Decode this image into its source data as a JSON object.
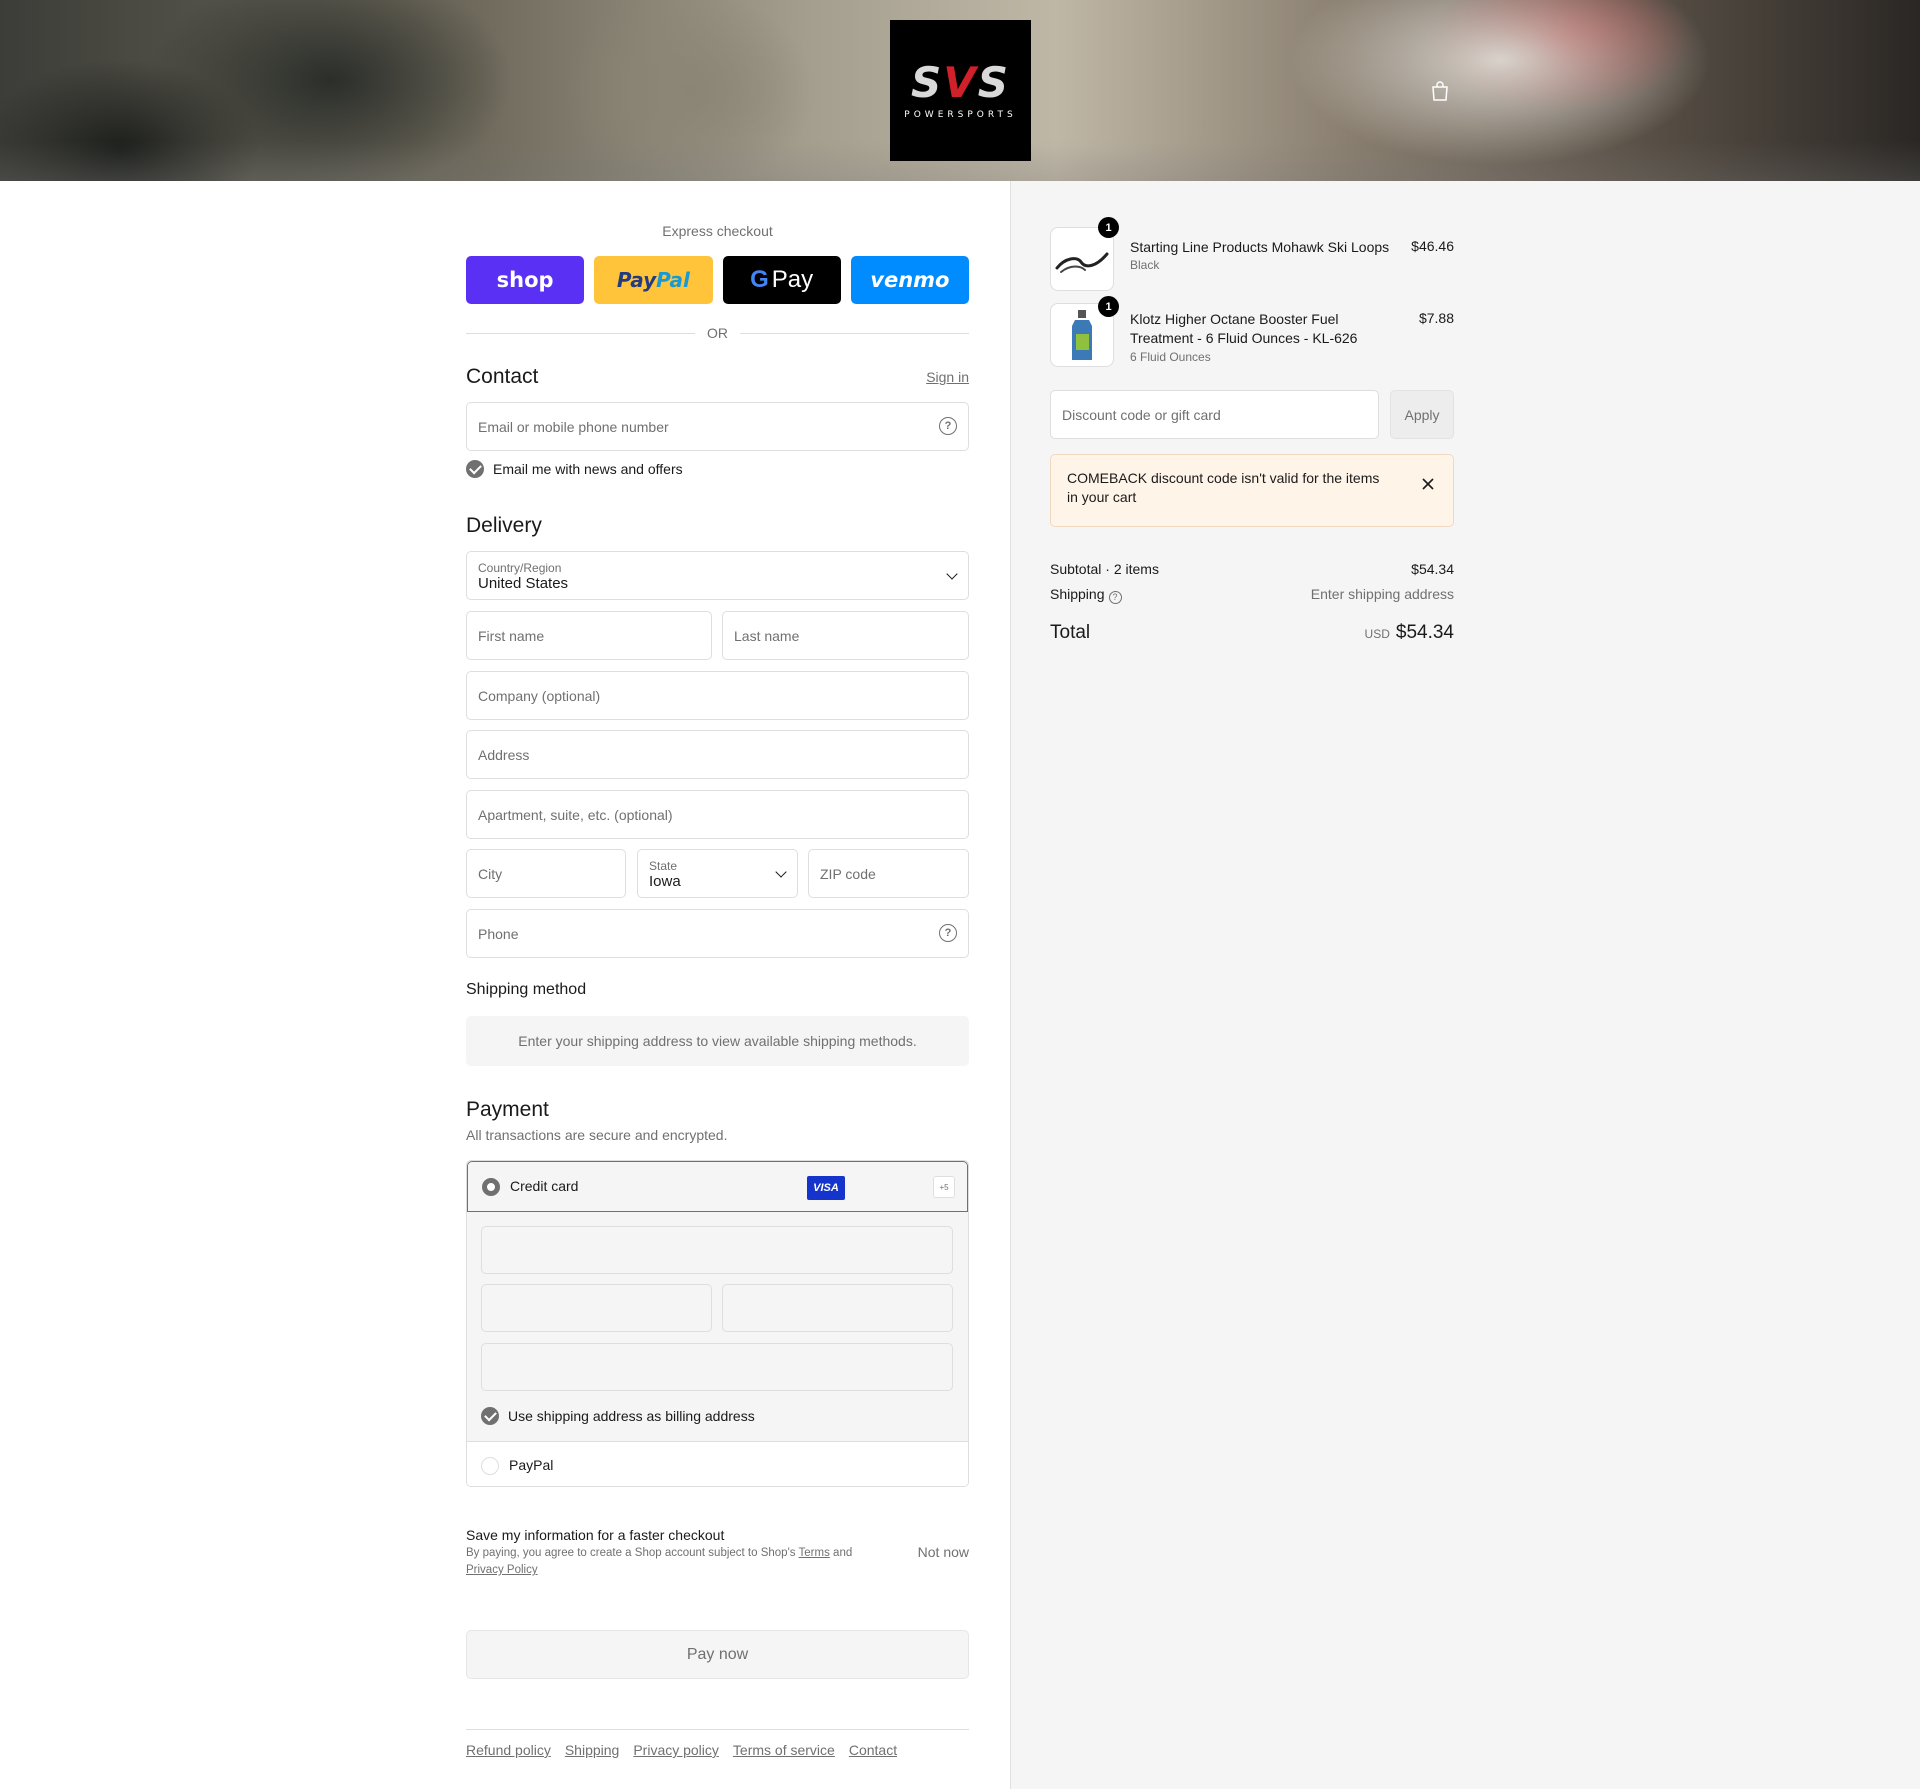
{
  "brand": {
    "logo_text": "SVS",
    "logo_sub": "POWERSPORTS"
  },
  "express": {
    "title": "Express checkout",
    "buttons": [
      "shop",
      "PayPal",
      "G Pay",
      "venmo"
    ],
    "or": "OR"
  },
  "contact": {
    "title": "Contact",
    "sign_in": "Sign in",
    "email_placeholder": "Email or mobile phone number",
    "newsletter": "Email me with news and offers"
  },
  "delivery": {
    "title": "Delivery",
    "country_label": "Country/Region",
    "country_value": "United States",
    "first_name": "First name",
    "last_name": "Last name",
    "company": "Company (optional)",
    "address": "Address",
    "apartment": "Apartment, suite, etc. (optional)",
    "city": "City",
    "state_label": "State",
    "state_value": "Iowa",
    "zip": "ZIP code",
    "phone": "Phone"
  },
  "shipping_method": {
    "title": "Shipping method",
    "message": "Enter your shipping address to view available shipping methods."
  },
  "payment": {
    "title": "Payment",
    "subtitle": "All transactions are secure and encrypted.",
    "credit_card": "Credit card",
    "visa": "VISA",
    "more": "+5",
    "billing_same": "Use shipping address as billing address",
    "paypal": "PayPal"
  },
  "save_info": {
    "title": "Save my information for a faster checkout",
    "text_1": "By paying, you agree to create a Shop account subject to Shop's",
    "terms": "Terms",
    "and": "and",
    "privacy": "Privacy Policy",
    "not_now": "Not now"
  },
  "pay_now": "Pay now",
  "footer": [
    "Refund policy",
    "Shipping",
    "Privacy policy",
    "Terms of service",
    "Contact"
  ],
  "cart": {
    "items": [
      {
        "qty": "1",
        "name": "Starting Line Products Mohawk Ski Loops",
        "variant": "Black",
        "price": "$46.46"
      },
      {
        "qty": "1",
        "name": "Klotz Higher Octane Booster Fuel Treatment - 6 Fluid Ounces - KL-626",
        "variant": "6 Fluid Ounces",
        "price": "$7.88"
      }
    ],
    "discount_placeholder": "Discount code or gift card",
    "apply": "Apply",
    "alert": "COMEBACK discount code isn't valid for the items in your cart",
    "subtotal_label": "Subtotal · 2 items",
    "subtotal_value": "$54.34",
    "shipping_label": "Shipping",
    "shipping_value": "Enter shipping address",
    "total_label": "Total",
    "currency": "USD",
    "total_value": "$54.34"
  },
  "colors": {
    "shop": "#5a31f4",
    "paypal": "#ffc439",
    "venmo": "#008cff",
    "visa": "#1434cb"
  }
}
